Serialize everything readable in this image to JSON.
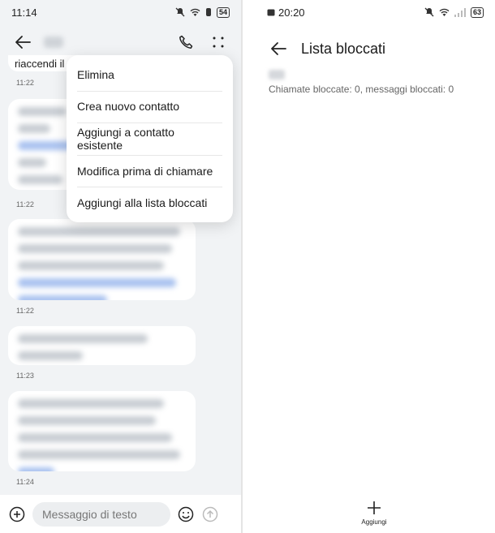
{
  "left": {
    "status": {
      "time": "11:14",
      "battery": "54"
    },
    "toolbar": {
      "back_icon": "arrow-left-icon",
      "call_icon": "phone-icon",
      "more_icon": "more-dots-icon"
    },
    "chat": {
      "partial_text": "riaccendi il",
      "timestamps": [
        "11:22",
        "11:22",
        "11:22",
        "11:23",
        "11:24"
      ]
    },
    "menu": {
      "items": [
        {
          "label": "Elimina"
        },
        {
          "label": "Crea nuovo contatto"
        },
        {
          "label": "Aggiungi a contatto esistente"
        },
        {
          "label": "Modifica prima di chiamare"
        },
        {
          "label": "Aggiungi alla lista bloccati"
        }
      ]
    },
    "composer": {
      "placeholder": "Messaggio di testo"
    }
  },
  "right": {
    "status": {
      "time": "20:20",
      "battery": "63"
    },
    "title": "Lista bloccati",
    "blocked": {
      "summary": "Chiamate bloccate: 0, messaggi bloccati: 0"
    },
    "add": {
      "label": "Aggiungi"
    }
  }
}
